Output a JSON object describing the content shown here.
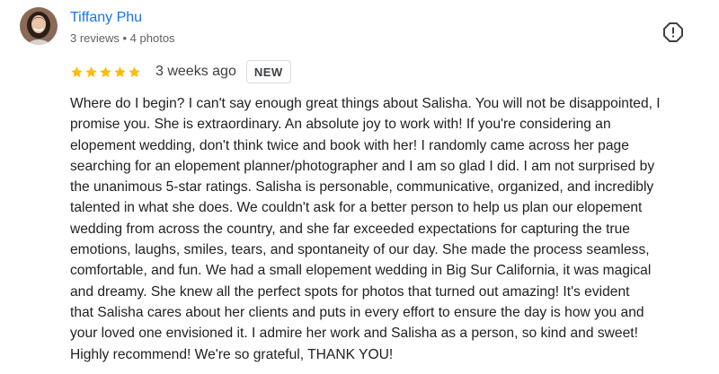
{
  "author": {
    "name": "Tiffany Phu",
    "meta": "3 reviews • 4 photos",
    "avatar_icon": "profile-photo"
  },
  "review": {
    "rating": 5,
    "rating_max": 5,
    "star_color": "#fbbc04",
    "date": "3 weeks ago",
    "badge": "NEW",
    "lines": [
      "Where do I begin? I can't say enough great things about Salisha. You will not be disappointed, I",
      "promise you. She is extraordinary. An absolute joy to work with! If you're considering an",
      "elopement wedding, don't think twice and book with her! I randomly came across her page",
      "searching for an elopement planner/photographer and I am so glad I did. I am not surprised by",
      "the unanimous 5-star ratings. Salisha is personable, communicative, organized, and incredibly",
      "talented in what she does. We couldn't ask for a better person to help us plan our elopement",
      "wedding from across the country, and she far exceeded expectations for capturing the true",
      "emotions, laughs, smiles, tears, and spontaneity of our day. She made the process seamless,",
      "comfortable, and fun. We had a small elopement wedding in Big Sur California, it was magical",
      "and dreamy. She knew all the perfect spots for photos that turned out amazing! It's evident",
      "that Salisha cares about her clients and puts in every effort to ensure the day is how you and",
      "your loved one envisioned it. I admire her work and Salisha as a person, so kind and sweet!",
      "Highly recommend! We're so grateful, THANK YOU!"
    ]
  },
  "actions": {
    "report_icon": "report-icon"
  },
  "colors": {
    "link": "#1a73e8",
    "secondary_text": "#5f6368",
    "body_text": "#202124"
  }
}
